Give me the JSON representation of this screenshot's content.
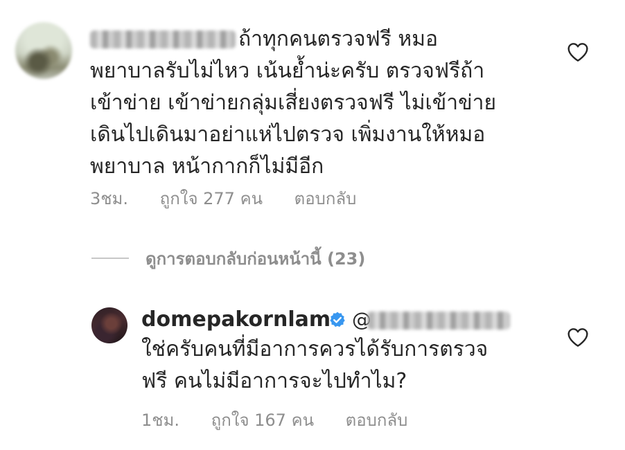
{
  "comment1": {
    "text_lines": [
      "ถ้าทุกคนตรวจฟรี หมอ",
      "พยาบาลรับไม่ไหว เน้นย้ำน่ะครับ ตรวจฟรีถ้า",
      "เข้าข่าย เข้าข่ายกลุ่มเสี่ยงตรวจฟรี ไม่เข้าข่าย",
      "เดินไปเดินมาอย่าแห่ไปตรวจ เพิ่มงานให้หมอ",
      "พยาบาล หน้ากากก็ไม่มีอีก"
    ],
    "time": "3ชม.",
    "likes": "ถูกใจ 277 คน",
    "reply": "ตอบกลับ",
    "heart_icon": "heart-outline-icon"
  },
  "view_replies": {
    "label": "ดูการตอบกลับก่อนหน้านี้ (23)"
  },
  "comment2": {
    "username": "domepakornlam",
    "verified_icon": "verified-badge-icon",
    "mention": "@",
    "text_lines": [
      "ใช่ครับคนที่มีอาการควรได้รับการตรวจ",
      "ฟรี คนไม่มีอาการจะไปทำไม?"
    ],
    "time": "1ชม.",
    "likes": "ถูกใจ 167 คน",
    "reply": "ตอบกลับ",
    "heart_icon": "heart-outline-icon"
  },
  "colors": {
    "text": "#262626",
    "secondary": "#8e8e8e",
    "verified": "#3897f0"
  }
}
